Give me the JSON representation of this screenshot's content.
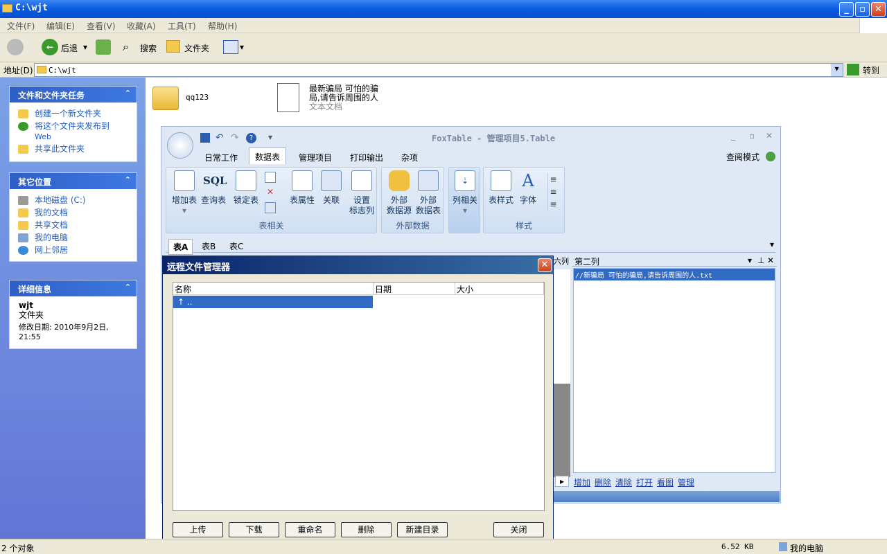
{
  "window": {
    "title": "C:\\wjt"
  },
  "menu": [
    "文件(F)",
    "编辑(E)",
    "查看(V)",
    "收藏(A)",
    "工具(T)",
    "帮助(H)"
  ],
  "toolbar": {
    "back": "后退",
    "search": "搜索",
    "folders": "文件夹"
  },
  "address": {
    "label": "地址(D)",
    "value": "C:\\wjt",
    "go": "转到"
  },
  "tasks": {
    "title": "文件和文件夹任务",
    "items": [
      "创建一个新文件夹",
      "将这个文件夹发布到",
      "Web",
      "共享此文件夹"
    ]
  },
  "places": {
    "title": "其它位置",
    "items": [
      "本地磁盘 (C:)",
      "我的文档",
      "共享文档",
      "我的电脑",
      "网上邻居"
    ]
  },
  "details": {
    "title": "详细信息",
    "name": "wjt",
    "type": "文件夹",
    "modified": "修改日期: 2010年9月2日,",
    "time": "21:55"
  },
  "files": [
    {
      "name": "qq123"
    },
    {
      "name_line1": "最新骗局 可怕的骗",
      "name_line2": "局,请告诉周围的人",
      "type": "文本文档"
    }
  ],
  "foxtable": {
    "title": "FoxTable - 管理项目5.Table",
    "tabs": [
      "日常工作",
      "数据表",
      "管理项目",
      "打印输出",
      "杂项"
    ],
    "view_mode": "查阅模式",
    "group1": {
      "label": "表相关",
      "buttons": [
        "增加表",
        "查询表",
        "锁定表",
        "表属性",
        "关联",
        "设置",
        "标志列"
      ],
      "sql": "SQL"
    },
    "group2": {
      "label": "外部数据",
      "buttons": [
        "外部",
        "数据源",
        "外部",
        "数据表"
      ]
    },
    "group3": {
      "label": "",
      "buttons": [
        "列相关"
      ]
    },
    "group4": {
      "label": "样式",
      "buttons": [
        "表样式",
        "字体"
      ]
    },
    "sheet_tabs": [
      "表A",
      "表B",
      "表C"
    ],
    "side_header": "第二列",
    "side_item": "//新骗局 可怕的骗局,请告诉周围的人.txt",
    "links": [
      "增加",
      "删除",
      "清除",
      "打开",
      "看图",
      "管理"
    ],
    "partial_col": "六列"
  },
  "dialog": {
    "title": "远程文件管理器",
    "columns": [
      "名称",
      "日期",
      "大小"
    ],
    "row": "..",
    "buttons": [
      "上传",
      "下载",
      "重命名",
      "删除",
      "新建目录",
      "关闭"
    ]
  },
  "status": {
    "objects": "2 个对象",
    "size": "6.52 KB",
    "location": "我的电脑"
  }
}
